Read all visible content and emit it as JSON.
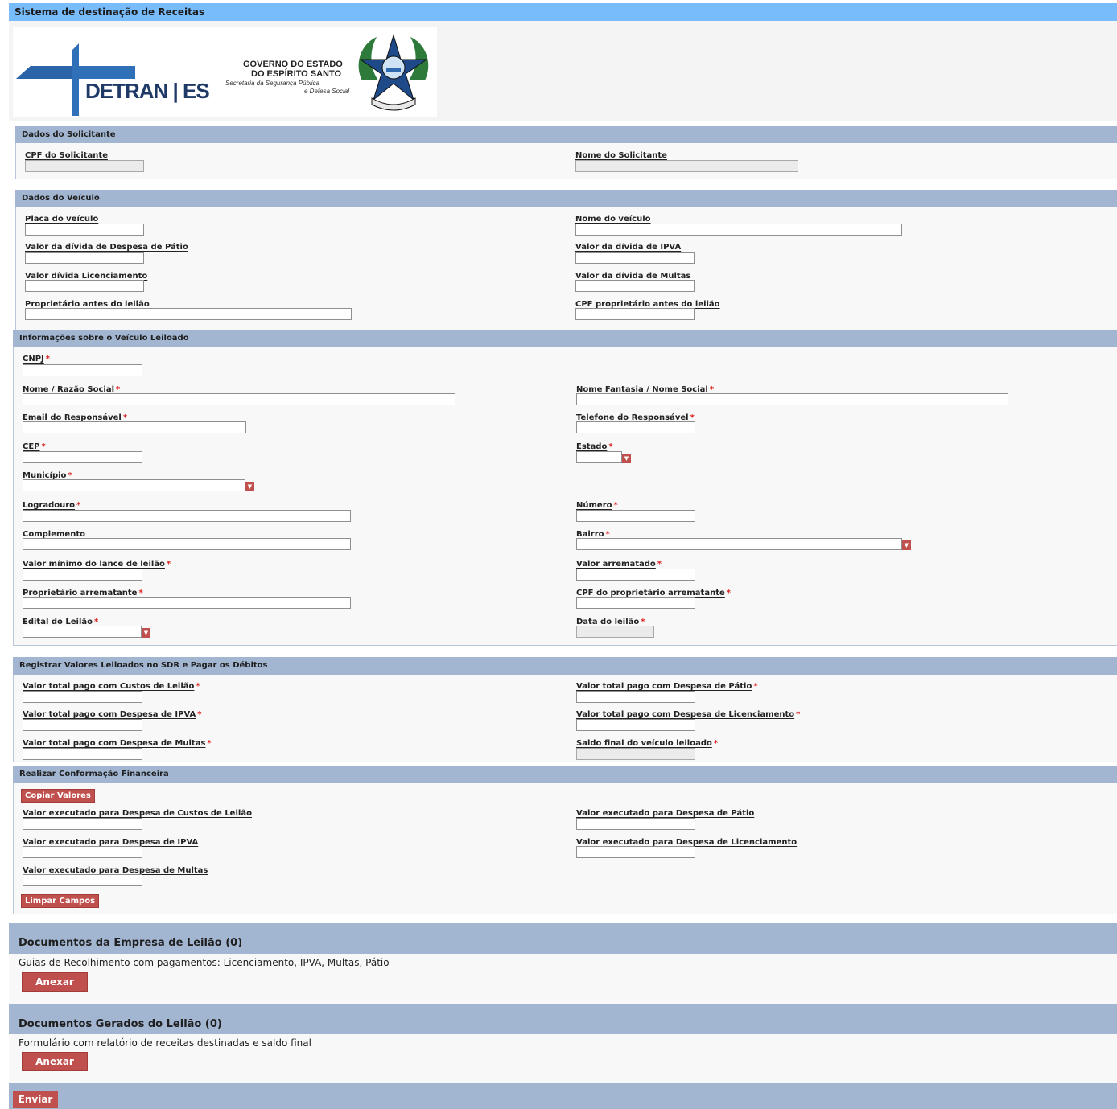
{
  "app": {
    "title": "Sistema de destinação de Receitas"
  },
  "logo": {
    "detran_text": "DETRAN | ES",
    "gov_line1": "GOVERNO DO ESTADO",
    "gov_line2": "DO ESPÍRITO SANTO",
    "gov_line3": "Secretaria da Segurança Pública",
    "gov_line4": "e Defesa Social"
  },
  "solicitante": {
    "title": "Dados do Solicitante",
    "cpf_label": "CPF do Solicitante",
    "nome_label": "Nome do Solicitante"
  },
  "veiculo": {
    "title": "Dados do Veículo",
    "placa_label": "Placa do veículo",
    "nome_label": "Nome do veículo",
    "patio_label": "Valor da dívida de Despesa de Pátio",
    "ipva_label": "Valor da dívida de IPVA",
    "licenciamento_label": "Valor dívida Licenciamento",
    "multas_label": "Valor da dívida de Multas",
    "proprietario_label": "Proprietário antes do leilão",
    "cpf_proprietario_label": "CPF proprietário antes do leilão"
  },
  "leiloado": {
    "title": "Informações sobre o Veículo Leiloado",
    "cnpj_label": "CNPJ",
    "razao_label": "Nome / Razão Social",
    "fantasia_label": "Nome Fantasia / Nome Social",
    "email_label": "Email do Responsável",
    "telefone_label": "Telefone do Responsável",
    "cep_label": "CEP",
    "estado_label": "Estado",
    "municipio_label": "Município",
    "logradouro_label": "Logradouro",
    "numero_label": "Número",
    "complemento_label": "Complemento",
    "bairro_label": "Bairro",
    "lance_label": "Valor mínimo do lance de leilão",
    "arrematado_label": "Valor arrematado",
    "arrematante_label": "Proprietário arrematante",
    "cpf_arrematante_label": "CPF do proprietário arrematante",
    "edital_label": "Edital do Leilão",
    "data_label": "Data do leilão",
    "required_mark": "*"
  },
  "registrar": {
    "title": "Registrar Valores Leiloados no SDR e Pagar os Débitos",
    "custos_label": "Valor total pago com Custos de Leilão",
    "patio_label": "Valor total pago com Despesa de Pátio",
    "ipva_label": "Valor total pago com Despesa de IPVA",
    "licenciamento_label": "Valor total pago com Despesa de Licenciamento",
    "multas_label": "Valor total pago com Despesa de Multas",
    "saldo_label": "Saldo final do veículo leiloado"
  },
  "conformacao": {
    "title": "Realizar Conformação Financeira",
    "copiar_button": "Copiar Valores",
    "custos_label": "Valor executado para Despesa de Custos de Leilão",
    "patio_label": "Valor executado para Despesa de Pátio",
    "ipva_label": "Valor executado para Despesa de IPVA",
    "licenciamento_label": "Valor executado para Despesa de Licenciamento",
    "multas_label": "Valor executado para Despesa de Multas",
    "limpar_button": "Limpar Campos"
  },
  "docs_empresa": {
    "title": "Documentos da Empresa de Leilão (0)",
    "description": "Guias de Recolhimento com pagamentos: Licenciamento, IPVA, Multas, Pátio",
    "button": "Anexar"
  },
  "docs_gerados": {
    "title": "Documentos Gerados do Leilão (0)",
    "description": "Formulário com relatório de receitas destinadas e saldo final",
    "button": "Anexar"
  },
  "footer": {
    "enviar_button": "Enviar"
  },
  "colors": {
    "title_bar": "#79bcfc",
    "section_header": "#a2b6d1",
    "button": "#c0504d",
    "required": "#dd2222"
  }
}
